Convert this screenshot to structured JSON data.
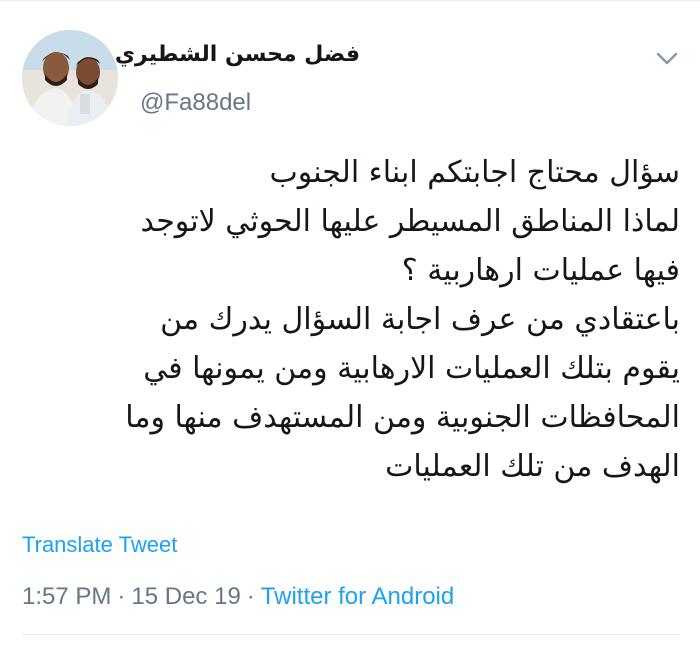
{
  "tweet": {
    "author": {
      "display_name": "فضل محسن الشطيري",
      "handle": "@Fa88del",
      "avatar_icon": "profile-photo-two-men"
    },
    "menu_icon": "chevron-down-icon",
    "lines": [
      "سؤال محتاج اجابتكم ابناء الجنوب",
      "لماذا المناطق المسيطر عليها الحوثي لاتوجد",
      "فيها عمليات ارهاربية ؟",
      "باعتقادي من عرف اجابة السؤال يدرك من",
      "يقوم بتلك العمليات الارهابية ومن يمونها في",
      "المحافظات الجنوبية ومن المستهدف منها وما",
      "الهدف من تلك العمليات"
    ],
    "translate_label": "Translate Tweet",
    "time": "1:57 PM",
    "separator": "·",
    "date": "15 Dec 19",
    "source": "Twitter for Android"
  },
  "colors": {
    "text": "#14171a",
    "secondary": "#657786",
    "link": "#1da1f2",
    "divider": "#e6ecf0"
  }
}
